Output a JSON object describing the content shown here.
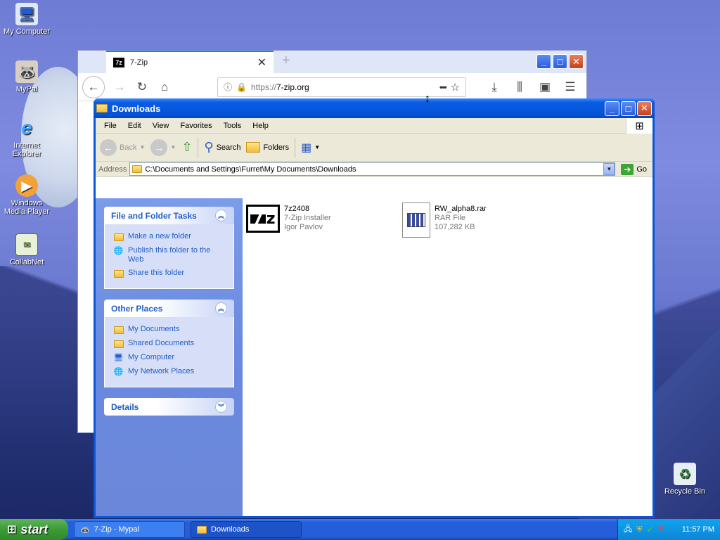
{
  "desktop": {
    "icons": [
      {
        "label": "My Computer",
        "icon": "my-computer-icon"
      },
      {
        "label": "MyPal",
        "icon": "mypal-icon"
      },
      {
        "label": "Internet Explorer",
        "icon": "internet-explorer-icon"
      },
      {
        "label": "Windows Media Player",
        "icon": "media-player-icon"
      },
      {
        "label": "CollabNet",
        "icon": "collabnet-icon"
      },
      {
        "label": "Recycle Bin",
        "icon": "recycle-bin-icon"
      }
    ]
  },
  "browser": {
    "tab_title": "7-Zip",
    "tab_favicon": "7z",
    "url_prefix": "https://",
    "url_host": "7-zip.org",
    "menu_dots": "•••"
  },
  "explorer": {
    "title": "Downloads",
    "menu": [
      "File",
      "Edit",
      "View",
      "Favorites",
      "Tools",
      "Help"
    ],
    "toolbar": {
      "back": "Back",
      "search": "Search",
      "folders": "Folders"
    },
    "address_label": "Address",
    "address_path": "C:\\Documents and Settings\\Furret\\My Documents\\Downloads",
    "go_label": "Go",
    "tasks": {
      "file_folder": {
        "title": "File and Folder Tasks",
        "items": [
          "Make a new folder",
          "Publish this folder to the Web",
          "Share this folder"
        ]
      },
      "other_places": {
        "title": "Other Places",
        "items": [
          "My Documents",
          "Shared Documents",
          "My Computer",
          "My Network Places"
        ]
      },
      "details": {
        "title": "Details"
      }
    },
    "files": [
      {
        "name": "7z2408",
        "type": "7-Zip Installer",
        "meta": "Igor Pavlov"
      },
      {
        "name": "RW_alpha8.rar",
        "type": "RAR File",
        "meta": "107,282 KB"
      }
    ]
  },
  "taskbar": {
    "start": "start",
    "tasks": [
      "7-Zip - Mypal",
      "Downloads"
    ],
    "clock": "11:57 PM"
  }
}
